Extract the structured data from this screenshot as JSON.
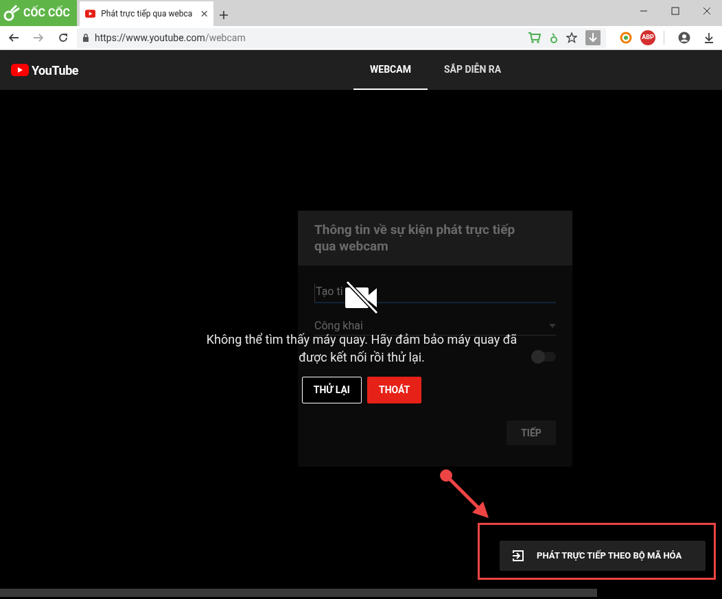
{
  "browser": {
    "brand": "CỐC CỐC",
    "tab_title": "Phát trực tiếp qua webca",
    "url_host": "https://www.youtube.com",
    "url_path": "/webcam",
    "adblock_label": "ABP"
  },
  "header": {
    "logo": "YouTube",
    "tabs": [
      {
        "label": "WEBCAM",
        "selected": true
      },
      {
        "label": "SẮP DIỄN RA",
        "selected": false
      }
    ]
  },
  "background_dialog": {
    "title": "Thông tin về sự kiện phát trực tiếp qua webcam",
    "title_placeholder": "Tạo ti",
    "privacy": "Công khai",
    "schedule_toggle": {
      "on": false
    },
    "next_button": {
      "label": "TIẾP",
      "disabled": true
    }
  },
  "error": {
    "message": "Không thể tìm thấy máy quay. Hãy đảm bảo máy quay đã được kết nối rồi thử lại.",
    "buttons": [
      {
        "label": "THỬ LẠI",
        "kind": "outline"
      },
      {
        "label": "THOÁT",
        "kind": "primary"
      }
    ]
  },
  "encoder_button": {
    "label": "PHÁT TRỰC TIẾP THEO BỘ MÃ HÓA"
  }
}
